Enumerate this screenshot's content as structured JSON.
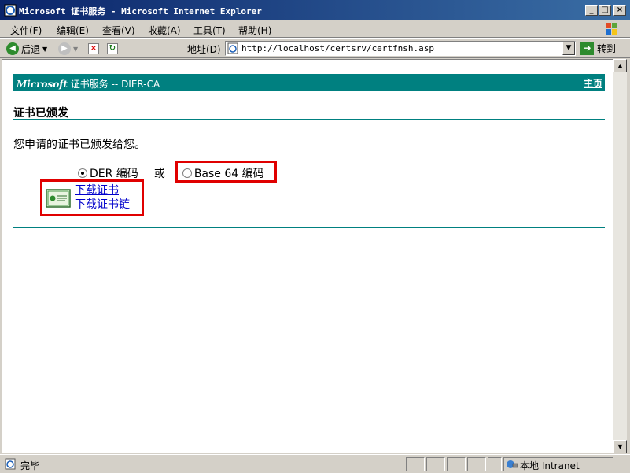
{
  "window": {
    "title": "Microsoft 证书服务 - Microsoft Internet Explorer",
    "minimize": "_",
    "maximize": "□",
    "close": "×"
  },
  "menu": {
    "items": [
      "文件(F)",
      "编辑(E)",
      "查看(V)",
      "收藏(A)",
      "工具(T)",
      "帮助(H)"
    ]
  },
  "toolbar": {
    "back_label": "后退",
    "address_label": "地址(D)",
    "address_value": "http://localhost/certsrv/certfnsh.asp",
    "go_label": "转到"
  },
  "page": {
    "brand_name": "Microsoft",
    "brand_rest": "证书服务 --  DIER-CA",
    "home_link": "主页",
    "title": "证书已颁发",
    "message": "您申请的证书已颁发给您。",
    "encoding": {
      "der_label": "DER 编码",
      "or_label": "或",
      "base64_label": "Base 64 编码",
      "selected": "DER"
    },
    "links": {
      "download_cert": "下载证书",
      "download_chain": "下载证书链"
    }
  },
  "status": {
    "text": "完毕",
    "zone": "本地 Intranet"
  },
  "colors": {
    "banner": "#008080",
    "highlight": "#e00000",
    "titlebar": "#0a246a"
  }
}
